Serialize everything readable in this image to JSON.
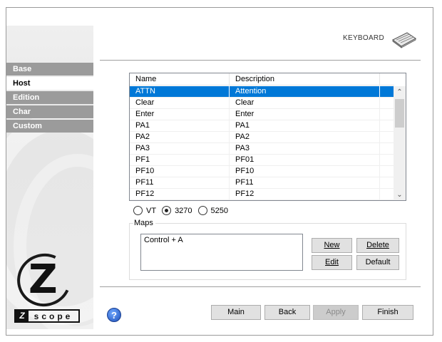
{
  "sidebar": {
    "items": [
      {
        "label": "Base",
        "active": false
      },
      {
        "label": "Host",
        "active": true
      },
      {
        "label": "Edition",
        "active": false
      },
      {
        "label": "Char",
        "active": false
      },
      {
        "label": "Custom",
        "active": false
      }
    ],
    "logo_text": "scope",
    "logo_letter": "Z"
  },
  "header": {
    "section_label": "KEYBOARD",
    "section_icon": "keyboard-icon"
  },
  "key_list": {
    "columns": [
      "Name",
      "Description"
    ],
    "rows": [
      {
        "name": "ATTN",
        "description": "Attention",
        "selected": true
      },
      {
        "name": "Clear",
        "description": "Clear"
      },
      {
        "name": "Enter",
        "description": "Enter"
      },
      {
        "name": "PA1",
        "description": "PA1"
      },
      {
        "name": "PA2",
        "description": "PA2"
      },
      {
        "name": "PA3",
        "description": "PA3"
      },
      {
        "name": "PF1",
        "description": "PF01"
      },
      {
        "name": "PF10",
        "description": "PF10"
      },
      {
        "name": "PF11",
        "description": "PF11"
      },
      {
        "name": "PF12",
        "description": "PF12"
      }
    ]
  },
  "emulation": {
    "options": [
      "VT",
      "3270",
      "5250"
    ],
    "selected": "3270"
  },
  "maps": {
    "legend": "Maps",
    "entries": [
      "Control + A"
    ],
    "new_label": "New",
    "delete_label": "Delete",
    "edit_label": "Edit",
    "default_label": "Default"
  },
  "footer": {
    "main_label": "Main",
    "back_label": "Back",
    "apply_label": "Apply",
    "finish_label": "Finish",
    "help_icon": "help-icon"
  },
  "colors": {
    "selection": "#0078d7",
    "nav_inactive": "#9b9b9b"
  }
}
